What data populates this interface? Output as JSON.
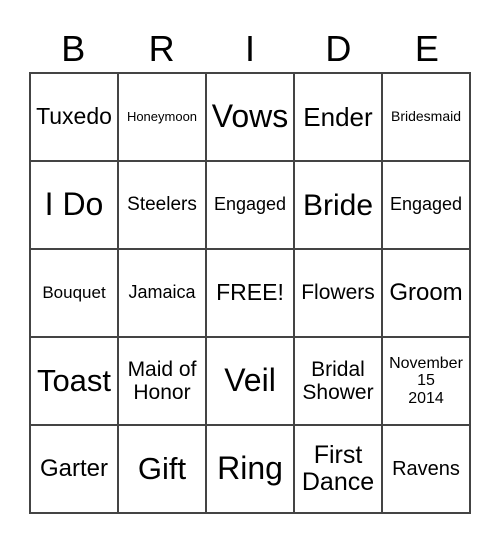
{
  "title_letters": [
    "B",
    "R",
    "I",
    "D",
    "E"
  ],
  "cells": [
    [
      "Tuxedo",
      "Honeymoon",
      "Vows",
      "Ender",
      "Bridesmaid"
    ],
    [
      "I Do",
      "Steelers",
      "Engaged",
      "Bride",
      "Engaged"
    ],
    [
      "Bouquet",
      "Jamaica",
      "FREE!",
      "Flowers",
      "Groom"
    ],
    [
      "Toast",
      "Maid of\nHonor",
      "Veil",
      "Bridal\nShower",
      "November\n15\n2014"
    ],
    [
      "Garter",
      "Gift",
      "Ring",
      "First\nDance",
      "Ravens"
    ]
  ]
}
